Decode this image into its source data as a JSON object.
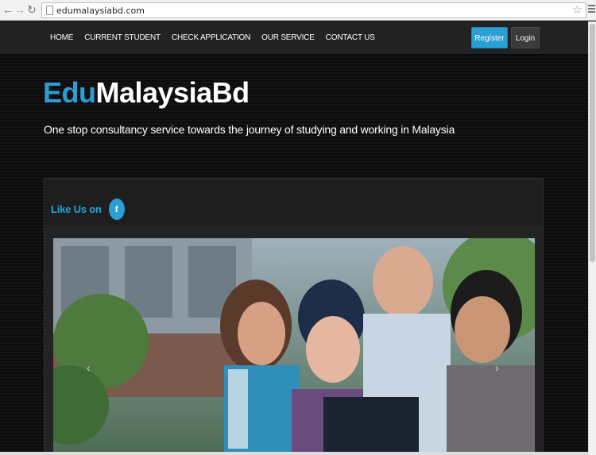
{
  "browser": {
    "url": "edumalaysiabd.com",
    "icons": [
      "back-arrow-icon",
      "forward-arrow-icon",
      "reload-icon",
      "page-icon",
      "star-icon",
      "menu-icon"
    ]
  },
  "nav": {
    "items": [
      "HOME",
      "CURRENT STUDENT",
      "CHECK APPLICATION",
      "OUR SERVICE",
      "CONTACT US"
    ],
    "register_label": "Register",
    "login_label": "Login"
  },
  "hero": {
    "brand_accent": "Edu",
    "brand_rest": "MalaysiaBd",
    "tagline": "One stop consultancy service towards the journey of studying and working in Malaysia"
  },
  "social": {
    "like_text": "Like Us on",
    "fb_glyph": "f"
  },
  "carousel": {
    "prev_glyph": "‹",
    "next_glyph": "›"
  },
  "colors": {
    "accent": "#2a9fd6",
    "navbar": "#222222",
    "background": "#111111"
  }
}
